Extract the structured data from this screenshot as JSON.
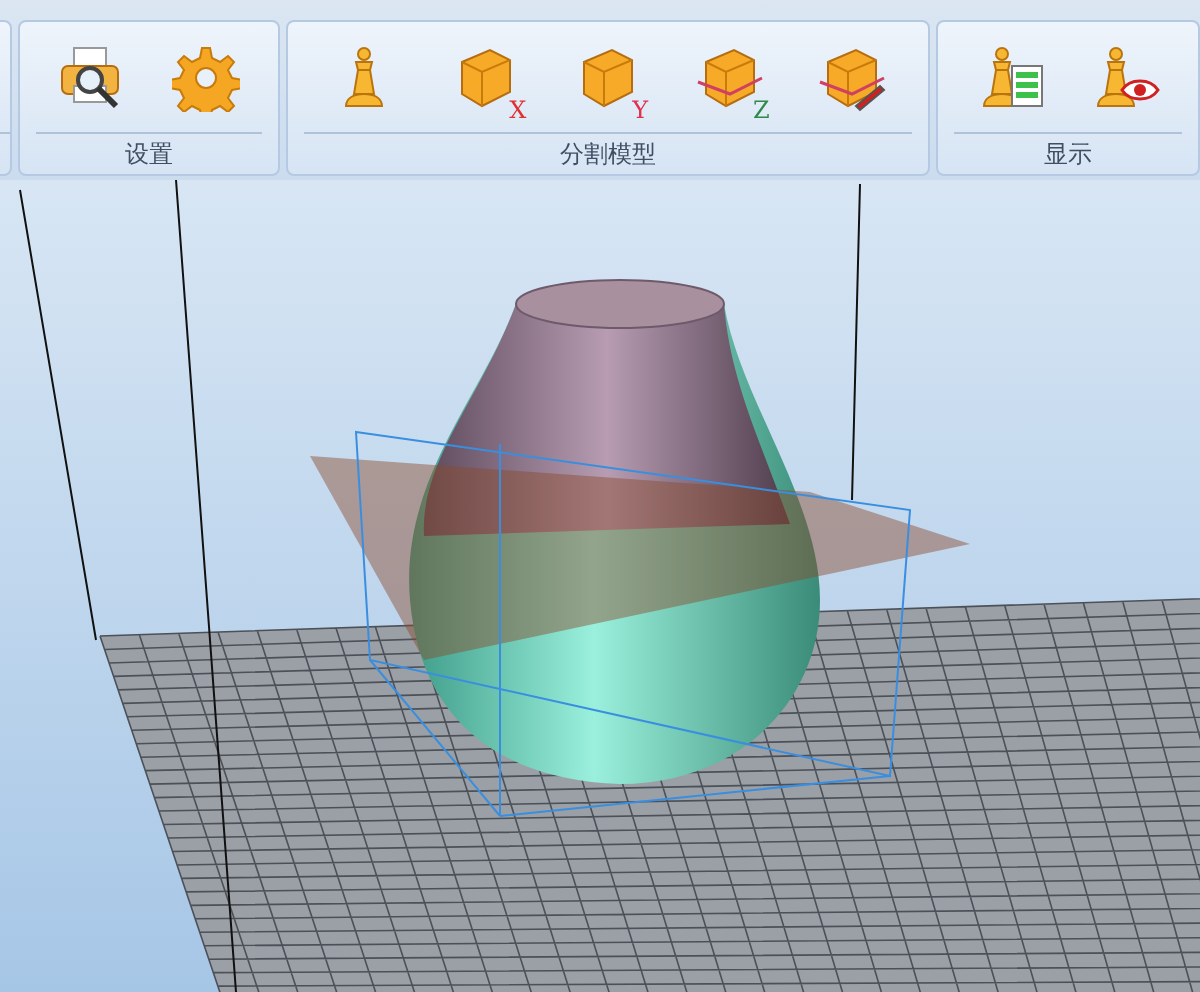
{
  "toolbar": {
    "groups": [
      {
        "kind": "partial"
      },
      {
        "label": "设置",
        "tools": [
          {
            "kind": "printer"
          },
          {
            "kind": "gear"
          }
        ]
      },
      {
        "label": "分割模型",
        "tools": [
          {
            "kind": "piece"
          },
          {
            "kind": "box",
            "axis_label": "X"
          },
          {
            "kind": "box",
            "axis_label": "Y"
          },
          {
            "kind": "slice",
            "axis_label": "Z"
          },
          {
            "kind": "cut"
          }
        ]
      },
      {
        "label": "显示",
        "tools": [
          {
            "kind": "piece-doc"
          },
          {
            "kind": "piece-eye"
          }
        ]
      }
    ]
  }
}
